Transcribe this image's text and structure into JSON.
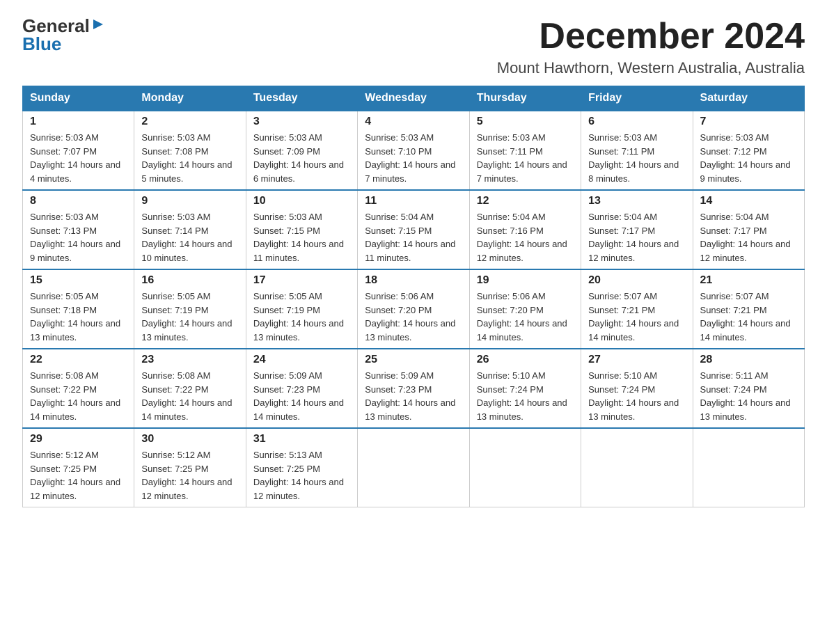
{
  "logo": {
    "general": "General",
    "triangle": "▶",
    "blue": "Blue"
  },
  "title": "December 2024",
  "subtitle": "Mount Hawthorn, Western Australia, Australia",
  "days": [
    "Sunday",
    "Monday",
    "Tuesday",
    "Wednesday",
    "Thursday",
    "Friday",
    "Saturday"
  ],
  "weeks": [
    [
      {
        "day": 1,
        "sunrise": "5:03 AM",
        "sunset": "7:07 PM",
        "daylight": "14 hours and 4 minutes."
      },
      {
        "day": 2,
        "sunrise": "5:03 AM",
        "sunset": "7:08 PM",
        "daylight": "14 hours and 5 minutes."
      },
      {
        "day": 3,
        "sunrise": "5:03 AM",
        "sunset": "7:09 PM",
        "daylight": "14 hours and 6 minutes."
      },
      {
        "day": 4,
        "sunrise": "5:03 AM",
        "sunset": "7:10 PM",
        "daylight": "14 hours and 7 minutes."
      },
      {
        "day": 5,
        "sunrise": "5:03 AM",
        "sunset": "7:11 PM",
        "daylight": "14 hours and 7 minutes."
      },
      {
        "day": 6,
        "sunrise": "5:03 AM",
        "sunset": "7:11 PM",
        "daylight": "14 hours and 8 minutes."
      },
      {
        "day": 7,
        "sunrise": "5:03 AM",
        "sunset": "7:12 PM",
        "daylight": "14 hours and 9 minutes."
      }
    ],
    [
      {
        "day": 8,
        "sunrise": "5:03 AM",
        "sunset": "7:13 PM",
        "daylight": "14 hours and 9 minutes."
      },
      {
        "day": 9,
        "sunrise": "5:03 AM",
        "sunset": "7:14 PM",
        "daylight": "14 hours and 10 minutes."
      },
      {
        "day": 10,
        "sunrise": "5:03 AM",
        "sunset": "7:15 PM",
        "daylight": "14 hours and 11 minutes."
      },
      {
        "day": 11,
        "sunrise": "5:04 AM",
        "sunset": "7:15 PM",
        "daylight": "14 hours and 11 minutes."
      },
      {
        "day": 12,
        "sunrise": "5:04 AM",
        "sunset": "7:16 PM",
        "daylight": "14 hours and 12 minutes."
      },
      {
        "day": 13,
        "sunrise": "5:04 AM",
        "sunset": "7:17 PM",
        "daylight": "14 hours and 12 minutes."
      },
      {
        "day": 14,
        "sunrise": "5:04 AM",
        "sunset": "7:17 PM",
        "daylight": "14 hours and 12 minutes."
      }
    ],
    [
      {
        "day": 15,
        "sunrise": "5:05 AM",
        "sunset": "7:18 PM",
        "daylight": "14 hours and 13 minutes."
      },
      {
        "day": 16,
        "sunrise": "5:05 AM",
        "sunset": "7:19 PM",
        "daylight": "14 hours and 13 minutes."
      },
      {
        "day": 17,
        "sunrise": "5:05 AM",
        "sunset": "7:19 PM",
        "daylight": "14 hours and 13 minutes."
      },
      {
        "day": 18,
        "sunrise": "5:06 AM",
        "sunset": "7:20 PM",
        "daylight": "14 hours and 13 minutes."
      },
      {
        "day": 19,
        "sunrise": "5:06 AM",
        "sunset": "7:20 PM",
        "daylight": "14 hours and 14 minutes."
      },
      {
        "day": 20,
        "sunrise": "5:07 AM",
        "sunset": "7:21 PM",
        "daylight": "14 hours and 14 minutes."
      },
      {
        "day": 21,
        "sunrise": "5:07 AM",
        "sunset": "7:21 PM",
        "daylight": "14 hours and 14 minutes."
      }
    ],
    [
      {
        "day": 22,
        "sunrise": "5:08 AM",
        "sunset": "7:22 PM",
        "daylight": "14 hours and 14 minutes."
      },
      {
        "day": 23,
        "sunrise": "5:08 AM",
        "sunset": "7:22 PM",
        "daylight": "14 hours and 14 minutes."
      },
      {
        "day": 24,
        "sunrise": "5:09 AM",
        "sunset": "7:23 PM",
        "daylight": "14 hours and 14 minutes."
      },
      {
        "day": 25,
        "sunrise": "5:09 AM",
        "sunset": "7:23 PM",
        "daylight": "14 hours and 13 minutes."
      },
      {
        "day": 26,
        "sunrise": "5:10 AM",
        "sunset": "7:24 PM",
        "daylight": "14 hours and 13 minutes."
      },
      {
        "day": 27,
        "sunrise": "5:10 AM",
        "sunset": "7:24 PM",
        "daylight": "14 hours and 13 minutes."
      },
      {
        "day": 28,
        "sunrise": "5:11 AM",
        "sunset": "7:24 PM",
        "daylight": "14 hours and 13 minutes."
      }
    ],
    [
      {
        "day": 29,
        "sunrise": "5:12 AM",
        "sunset": "7:25 PM",
        "daylight": "14 hours and 12 minutes."
      },
      {
        "day": 30,
        "sunrise": "5:12 AM",
        "sunset": "7:25 PM",
        "daylight": "14 hours and 12 minutes."
      },
      {
        "day": 31,
        "sunrise": "5:13 AM",
        "sunset": "7:25 PM",
        "daylight": "14 hours and 12 minutes."
      },
      null,
      null,
      null,
      null
    ]
  ]
}
